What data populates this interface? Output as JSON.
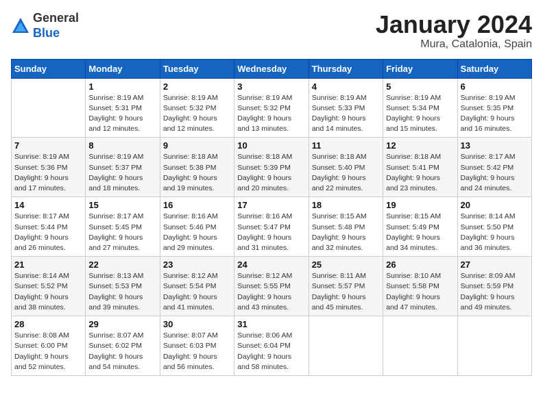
{
  "header": {
    "logo": {
      "general": "General",
      "blue": "Blue"
    },
    "title": "January 2024",
    "location": "Mura, Catalonia, Spain"
  },
  "weekdays": [
    "Sunday",
    "Monday",
    "Tuesday",
    "Wednesday",
    "Thursday",
    "Friday",
    "Saturday"
  ],
  "weeks": [
    [
      {
        "day": "",
        "info": ""
      },
      {
        "day": "1",
        "info": "Sunrise: 8:19 AM\nSunset: 5:31 PM\nDaylight: 9 hours\nand 12 minutes."
      },
      {
        "day": "2",
        "info": "Sunrise: 8:19 AM\nSunset: 5:32 PM\nDaylight: 9 hours\nand 12 minutes."
      },
      {
        "day": "3",
        "info": "Sunrise: 8:19 AM\nSunset: 5:32 PM\nDaylight: 9 hours\nand 13 minutes."
      },
      {
        "day": "4",
        "info": "Sunrise: 8:19 AM\nSunset: 5:33 PM\nDaylight: 9 hours\nand 14 minutes."
      },
      {
        "day": "5",
        "info": "Sunrise: 8:19 AM\nSunset: 5:34 PM\nDaylight: 9 hours\nand 15 minutes."
      },
      {
        "day": "6",
        "info": "Sunrise: 8:19 AM\nSunset: 5:35 PM\nDaylight: 9 hours\nand 16 minutes."
      }
    ],
    [
      {
        "day": "7",
        "info": "Sunrise: 8:19 AM\nSunset: 5:36 PM\nDaylight: 9 hours\nand 17 minutes."
      },
      {
        "day": "8",
        "info": "Sunrise: 8:19 AM\nSunset: 5:37 PM\nDaylight: 9 hours\nand 18 minutes."
      },
      {
        "day": "9",
        "info": "Sunrise: 8:18 AM\nSunset: 5:38 PM\nDaylight: 9 hours\nand 19 minutes."
      },
      {
        "day": "10",
        "info": "Sunrise: 8:18 AM\nSunset: 5:39 PM\nDaylight: 9 hours\nand 20 minutes."
      },
      {
        "day": "11",
        "info": "Sunrise: 8:18 AM\nSunset: 5:40 PM\nDaylight: 9 hours\nand 22 minutes."
      },
      {
        "day": "12",
        "info": "Sunrise: 8:18 AM\nSunset: 5:41 PM\nDaylight: 9 hours\nand 23 minutes."
      },
      {
        "day": "13",
        "info": "Sunrise: 8:17 AM\nSunset: 5:42 PM\nDaylight: 9 hours\nand 24 minutes."
      }
    ],
    [
      {
        "day": "14",
        "info": "Sunrise: 8:17 AM\nSunset: 5:44 PM\nDaylight: 9 hours\nand 26 minutes."
      },
      {
        "day": "15",
        "info": "Sunrise: 8:17 AM\nSunset: 5:45 PM\nDaylight: 9 hours\nand 27 minutes."
      },
      {
        "day": "16",
        "info": "Sunrise: 8:16 AM\nSunset: 5:46 PM\nDaylight: 9 hours\nand 29 minutes."
      },
      {
        "day": "17",
        "info": "Sunrise: 8:16 AM\nSunset: 5:47 PM\nDaylight: 9 hours\nand 31 minutes."
      },
      {
        "day": "18",
        "info": "Sunrise: 8:15 AM\nSunset: 5:48 PM\nDaylight: 9 hours\nand 32 minutes."
      },
      {
        "day": "19",
        "info": "Sunrise: 8:15 AM\nSunset: 5:49 PM\nDaylight: 9 hours\nand 34 minutes."
      },
      {
        "day": "20",
        "info": "Sunrise: 8:14 AM\nSunset: 5:50 PM\nDaylight: 9 hours\nand 36 minutes."
      }
    ],
    [
      {
        "day": "21",
        "info": "Sunrise: 8:14 AM\nSunset: 5:52 PM\nDaylight: 9 hours\nand 38 minutes."
      },
      {
        "day": "22",
        "info": "Sunrise: 8:13 AM\nSunset: 5:53 PM\nDaylight: 9 hours\nand 39 minutes."
      },
      {
        "day": "23",
        "info": "Sunrise: 8:12 AM\nSunset: 5:54 PM\nDaylight: 9 hours\nand 41 minutes."
      },
      {
        "day": "24",
        "info": "Sunrise: 8:12 AM\nSunset: 5:55 PM\nDaylight: 9 hours\nand 43 minutes."
      },
      {
        "day": "25",
        "info": "Sunrise: 8:11 AM\nSunset: 5:57 PM\nDaylight: 9 hours\nand 45 minutes."
      },
      {
        "day": "26",
        "info": "Sunrise: 8:10 AM\nSunset: 5:58 PM\nDaylight: 9 hours\nand 47 minutes."
      },
      {
        "day": "27",
        "info": "Sunrise: 8:09 AM\nSunset: 5:59 PM\nDaylight: 9 hours\nand 49 minutes."
      }
    ],
    [
      {
        "day": "28",
        "info": "Sunrise: 8:08 AM\nSunset: 6:00 PM\nDaylight: 9 hours\nand 52 minutes."
      },
      {
        "day": "29",
        "info": "Sunrise: 8:07 AM\nSunset: 6:02 PM\nDaylight: 9 hours\nand 54 minutes."
      },
      {
        "day": "30",
        "info": "Sunrise: 8:07 AM\nSunset: 6:03 PM\nDaylight: 9 hours\nand 56 minutes."
      },
      {
        "day": "31",
        "info": "Sunrise: 8:06 AM\nSunset: 6:04 PM\nDaylight: 9 hours\nand 58 minutes."
      },
      {
        "day": "",
        "info": ""
      },
      {
        "day": "",
        "info": ""
      },
      {
        "day": "",
        "info": ""
      }
    ]
  ]
}
